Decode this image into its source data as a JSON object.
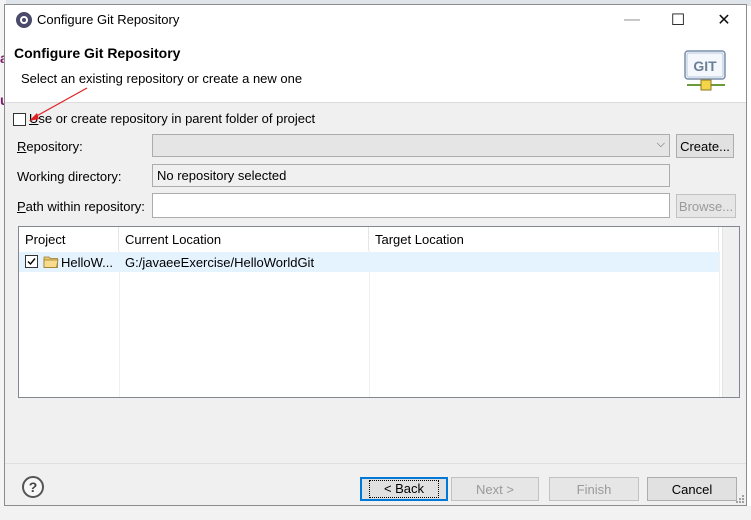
{
  "window": {
    "title": "Configure Git Repository",
    "controls": {
      "minimize": "—",
      "maximize": "☐",
      "close": "✕"
    }
  },
  "header": {
    "title": "Configure Git Repository",
    "description": "Select an existing repository or create a new one",
    "logo_text": "GIT"
  },
  "use_parent": {
    "label_u": "U",
    "label_rest": "se or create repository in parent folder of project",
    "checked": false
  },
  "repository": {
    "label_u": "R",
    "label_rest": "epository:",
    "value": "",
    "create_label": "Create..."
  },
  "working_directory": {
    "label": "Working directory:",
    "value": "No repository selected"
  },
  "path_within": {
    "label_u": "P",
    "label_rest": "ath within repository:",
    "value": "",
    "browse_label": "Browse..."
  },
  "table": {
    "columns": [
      "Project",
      "Current Location",
      "Target Location"
    ],
    "rows": [
      {
        "project": "HelloW...",
        "current_location": "G:/javaeeExercise/HelloWorldGit",
        "target_location": "",
        "checked": true
      }
    ]
  },
  "footer": {
    "help_glyph": "?",
    "back_label": "< Back",
    "next_label": "Next >",
    "finish_label": "Finish",
    "cancel_label": "Cancel"
  },
  "background": {
    "chars": [
      "a",
      "u"
    ]
  },
  "colors": {
    "selection": "#e5f3ff",
    "default_button_border": "#0078d7",
    "annotation_arrow": "#e02020"
  }
}
